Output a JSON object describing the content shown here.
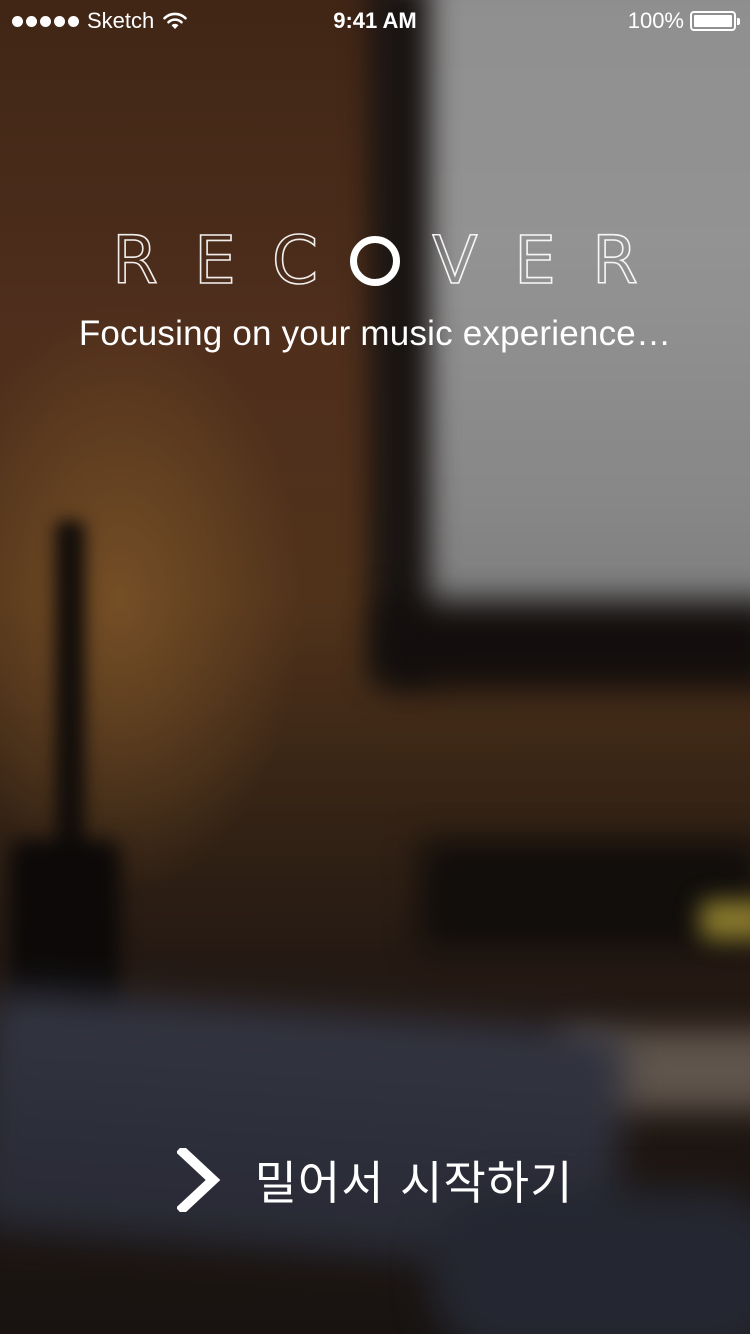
{
  "status_bar": {
    "carrier": "Sketch",
    "time": "9:41 AM",
    "battery": "100%",
    "battery_level": 1.0,
    "signal_icon": "signal-dots-icon",
    "wifi_icon": "wifi-icon",
    "battery_icon": "battery-icon"
  },
  "logo": {
    "letters": [
      "R",
      "E",
      "C",
      "O",
      "V",
      "E",
      "R"
    ]
  },
  "tagline": "Focusing on your music experience…",
  "swipe": {
    "label": "밀어서 시작하기",
    "icon": "chevron-right-icon"
  },
  "colors": {
    "text": "#ffffff"
  }
}
